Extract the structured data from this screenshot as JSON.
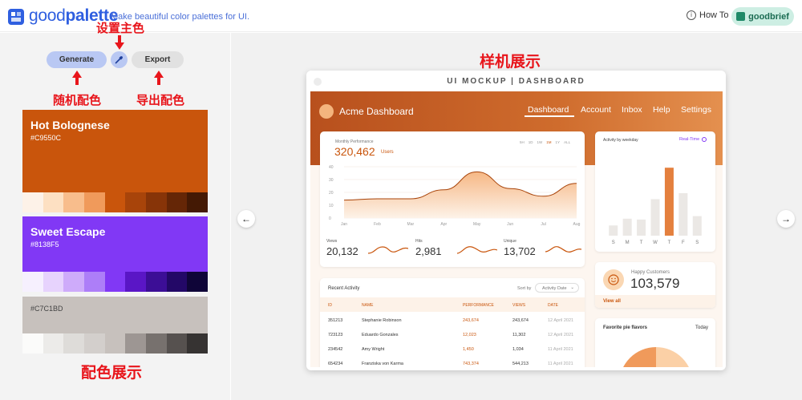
{
  "header": {
    "brand_light": "good",
    "brand_bold": "palette",
    "tagline": "Make beautiful color palettes for UI.",
    "howto_label": "How To",
    "goodbrief_label": "goodbrief"
  },
  "toolbar": {
    "generate_label": "Generate",
    "export_label": "Export"
  },
  "annotations": {
    "set_primary": "设置主色",
    "random": "随机配色",
    "export": "导出配色",
    "palette_display": "配色展示",
    "mockup_display": "样机展示"
  },
  "palettes": [
    {
      "name": "Hot Bolognese",
      "hex": "#C9550C",
      "main": "#c9550c",
      "shades": [
        "#fdf2e8",
        "#fde0c2",
        "#f8bd8c",
        "#f09a5b",
        "#c9550c",
        "#a8440a",
        "#873408",
        "#652606",
        "#441904"
      ]
    },
    {
      "name": "Sweet Escape",
      "hex": "#8138F5",
      "main": "#8138f5",
      "shades": [
        "#f6f0fe",
        "#e7d3fd",
        "#ceabfa",
        "#ad7ef8",
        "#8138f5",
        "#5a16c6",
        "#3c0e96",
        "#230867",
        "#0f0538"
      ]
    },
    {
      "name": "",
      "hex": "#C7C1BD",
      "main": "#c7c1bd",
      "shades": [
        "#fbfbfa",
        "#ecebe9",
        "#dedcd9",
        "#d3cfcc",
        "#c7c1bd",
        "#9d9693",
        "#77716e",
        "#56514f",
        "#363332"
      ]
    }
  ],
  "mockup": {
    "frame_title": "UI MOCKUP | DASHBOARD",
    "dashboard_title": "Acme Dashboard",
    "nav": [
      "Dashboard",
      "Account",
      "Inbox",
      "Help",
      "Settings"
    ],
    "performance": {
      "label": "Monthly Performance",
      "value": "320,462",
      "unit": "Users",
      "ranges": [
        "5H",
        "1D",
        "1W",
        "1M",
        "1Y",
        "ALL"
      ],
      "active_range": "1M",
      "y_ticks": [
        "40",
        "30",
        "20",
        "10",
        "0"
      ],
      "months": [
        "Jan",
        "Feb",
        "Mar",
        "Apr",
        "May",
        "Jun",
        "Jul",
        "Aug"
      ]
    },
    "stats": [
      {
        "label": "Views",
        "value": "20,132"
      },
      {
        "label": "Hits",
        "value": "2,981"
      },
      {
        "label": "Unique",
        "value": "13,702"
      }
    ],
    "weekday": {
      "title": "Activity by weekday",
      "toggle": "Real-Time",
      "days": [
        "S",
        "M",
        "T",
        "W",
        "T",
        "F",
        "S"
      ]
    },
    "customers": {
      "label": "Happy Customers",
      "value": "103,579",
      "link": "View all"
    },
    "pie": {
      "title": "Favorite pie flavors",
      "period": "Today"
    },
    "activity": {
      "title": "Recent Activity",
      "sort_label": "Sort by",
      "sort_value": "Activity Date",
      "columns": [
        "ID",
        "NAME",
        "PERFORMANCE",
        "VIEWS",
        "DATE"
      ],
      "rows": [
        {
          "id": "351213",
          "name": "Stephanie Robinson",
          "perf": "243,674",
          "views": "243,674",
          "date": "12 April 2021"
        },
        {
          "id": "723123",
          "name": "Eduardo Gonzales",
          "perf": "12,023",
          "views": "11,302",
          "date": "12 April 2021"
        },
        {
          "id": "234542",
          "name": "Amy Wright",
          "perf": "1,450",
          "views": "1,034",
          "date": "11 April 2021"
        },
        {
          "id": "654234",
          "name": "Franziska von Karma",
          "perf": "743,374",
          "views": "544,213",
          "date": "11 April 2021"
        }
      ]
    }
  },
  "chart_data": [
    {
      "type": "area",
      "title": "Monthly Performance",
      "x": [
        "Jan",
        "Feb",
        "Mar",
        "Apr",
        "May",
        "Jun",
        "Jul",
        "Aug"
      ],
      "series": [
        {
          "values": [
            14,
            15,
            15,
            22,
            36,
            23,
            17,
            27
          ]
        }
      ],
      "ylim": [
        0,
        40
      ]
    },
    {
      "type": "bar",
      "title": "Activity by weekday",
      "categories": [
        "S",
        "M",
        "T",
        "W",
        "T",
        "F",
        "S"
      ],
      "values": [
        12,
        20,
        19,
        43,
        80,
        50,
        23
      ],
      "ylim": [
        0,
        100
      ]
    }
  ]
}
